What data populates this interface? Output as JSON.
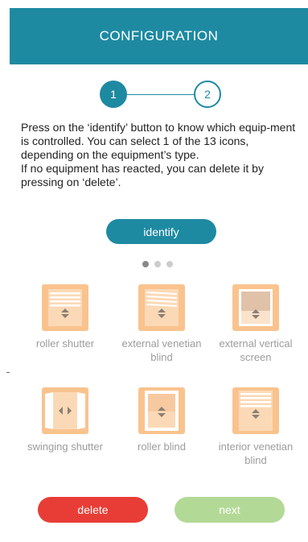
{
  "header": {
    "title": "CONFIGURATION"
  },
  "stepper": {
    "current": "1",
    "next": "2"
  },
  "instructions": {
    "line1": "Press on the ‘identify’ button to know which equip-ment is controlled. You can select 1 of the 13 icons, depending on the equipment’s type.",
    "line2": "If no equipment has reacted, you can delete it by pressing  on ‘delete’."
  },
  "identify_label": "identify",
  "pager": {
    "pages": 3,
    "active_page": 1
  },
  "equipment": [
    {
      "label": "roller shutter",
      "icon": "roller-shutter-icon"
    },
    {
      "label": "external venetian blind",
      "icon": "external-venetian-blind-icon"
    },
    {
      "label": "external vertical screen",
      "icon": "external-vertical-screen-icon"
    },
    {
      "label": "swinging shutter",
      "icon": "swinging-shutter-icon"
    },
    {
      "label": "roller blind",
      "icon": "roller-blind-icon"
    },
    {
      "label": "interior venetian blind",
      "icon": "interior-venetian-blind-icon"
    }
  ],
  "actions": {
    "delete_label": "delete",
    "next_label": "next"
  },
  "colors": {
    "primary": "#1e8aa2",
    "delete": "#e83d36",
    "next": "#b3d996",
    "icon_bg": "#f9c38e",
    "label": "#9c9c9c"
  }
}
